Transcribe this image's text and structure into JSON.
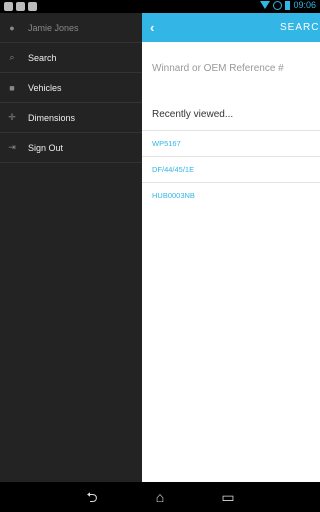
{
  "status": {
    "time": "09:06"
  },
  "drawer": {
    "user_name": "Jamie Jones",
    "items": [
      {
        "label": "Search",
        "icon": "search-icon"
      },
      {
        "label": "Vehicles",
        "icon": "car-icon"
      },
      {
        "label": "Dimensions",
        "icon": "move-icon"
      },
      {
        "label": "Sign Out",
        "icon": "sign-out-icon"
      }
    ]
  },
  "header": {
    "title": "SEARCH"
  },
  "search": {
    "placeholder": "Winnard or OEM Reference #"
  },
  "recent": {
    "title": "Recently viewed...",
    "items": [
      "WP5167",
      "DF/44/45/1E",
      "HUB0003NB"
    ]
  },
  "colors": {
    "accent": "#33b5e5",
    "drawer_bg": "#232323"
  }
}
